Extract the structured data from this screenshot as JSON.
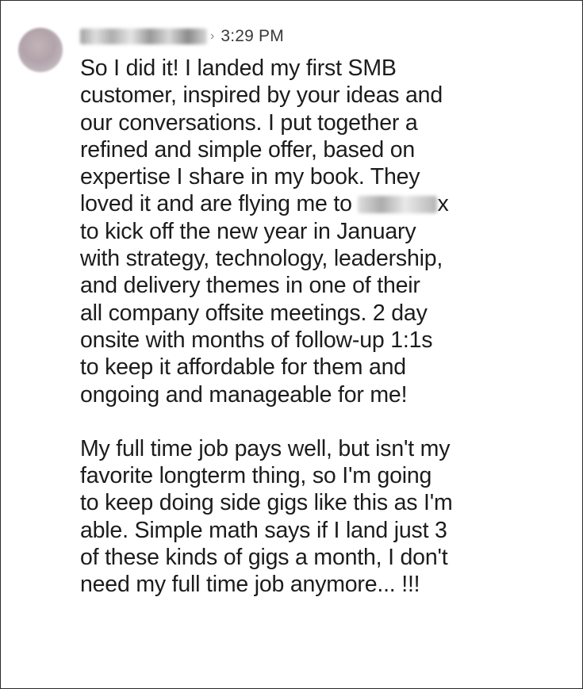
{
  "post": {
    "time": "3:29 PM",
    "separator": "›",
    "paragraph1": [
      "So I did it! I landed my first SMB",
      "customer, inspired by your ideas and",
      "our conversations. I put together a",
      "refined and simple offer, based on",
      "expertise I share in my book. They"
    ],
    "line6_prefix": "loved it and are flying me to",
    "line6_suffix": "x",
    "paragraph1_rest": [
      "to kick off the new year in January",
      "with strategy, technology, leadership,",
      "and delivery themes in one of their",
      "all company offsite meetings. 2 day",
      "onsite with months of follow-up 1:1s",
      "to keep it affordable for them and",
      "ongoing and manageable for me!"
    ],
    "paragraph2": [
      "My full time job pays well, but isn't my",
      "favorite longterm thing, so I'm going",
      "to keep doing side gigs like this as I'm",
      "able. Simple math says if I land just 3",
      "of these kinds of gigs a month, I don't",
      "need my full time job anymore... !!!"
    ]
  },
  "icons": {
    "avatar": "avatar-blurred",
    "name": "name-redacted",
    "location": "location-redacted"
  }
}
